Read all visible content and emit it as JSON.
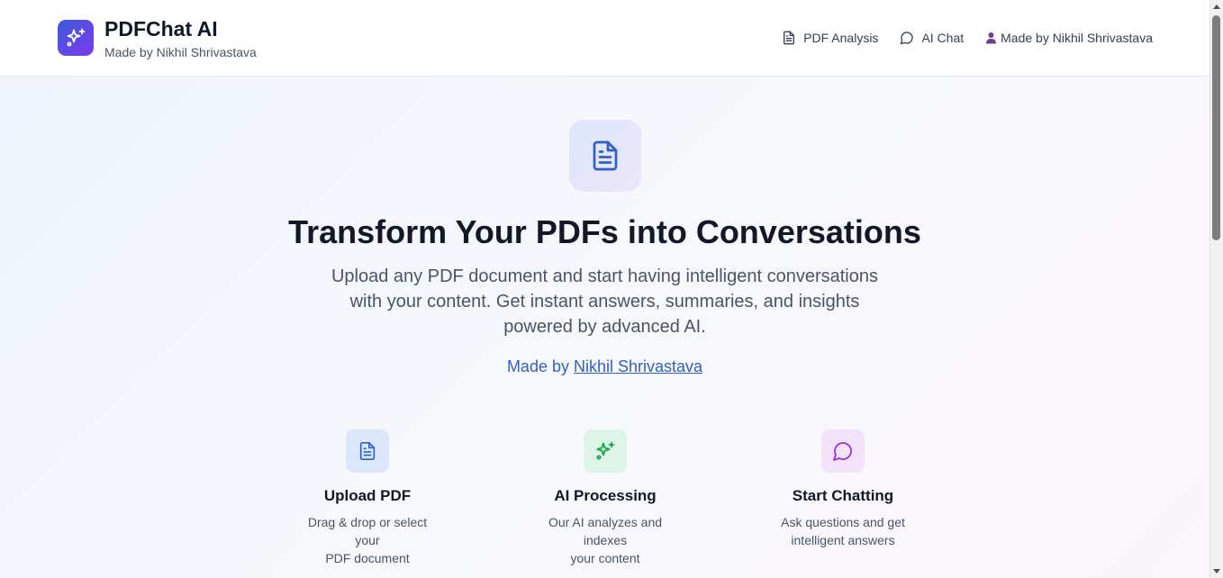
{
  "header": {
    "title": "PDFChat AI",
    "subtitle": "Made by Nikhil Shrivastava",
    "logo_icon": "sparkles-icon",
    "nav": [
      {
        "label": "PDF Analysis",
        "icon": "file-text-icon"
      },
      {
        "label": "AI Chat",
        "icon": "message-circle-icon"
      },
      {
        "label": "Made by Nikhil Shrivastava",
        "icon": "user-icon"
      }
    ]
  },
  "hero": {
    "icon": "file-text-icon",
    "title": "Transform Your PDFs into Conversations",
    "description_lines": [
      "Upload any PDF document and start having intelligent conversations",
      "with your content. Get instant answers, summaries, and insights",
      "powered by advanced AI."
    ],
    "made_by_prefix": "Made by",
    "made_by_link": "Nikhil Shrivastava"
  },
  "features": [
    {
      "icon": "file-text-icon",
      "title": "Upload PDF",
      "lines": [
        "Drag & drop or select your",
        "PDF document"
      ],
      "color": "#2f5fc9"
    },
    {
      "icon": "sparkles-icon",
      "title": "AI Processing",
      "lines": [
        "Our AI analyzes and indexes",
        "your content"
      ],
      "color": "#16a34a"
    },
    {
      "icon": "message-circle-icon",
      "title": "Start Chatting",
      "lines": [
        "Ask questions and get",
        "intelligent answers"
      ],
      "color": "#9333ea"
    }
  ],
  "colors": {
    "accent": "#2f5fc9",
    "brand_gradient_start": "#3b5bdb",
    "brand_gradient_end": "#7c3aed"
  }
}
